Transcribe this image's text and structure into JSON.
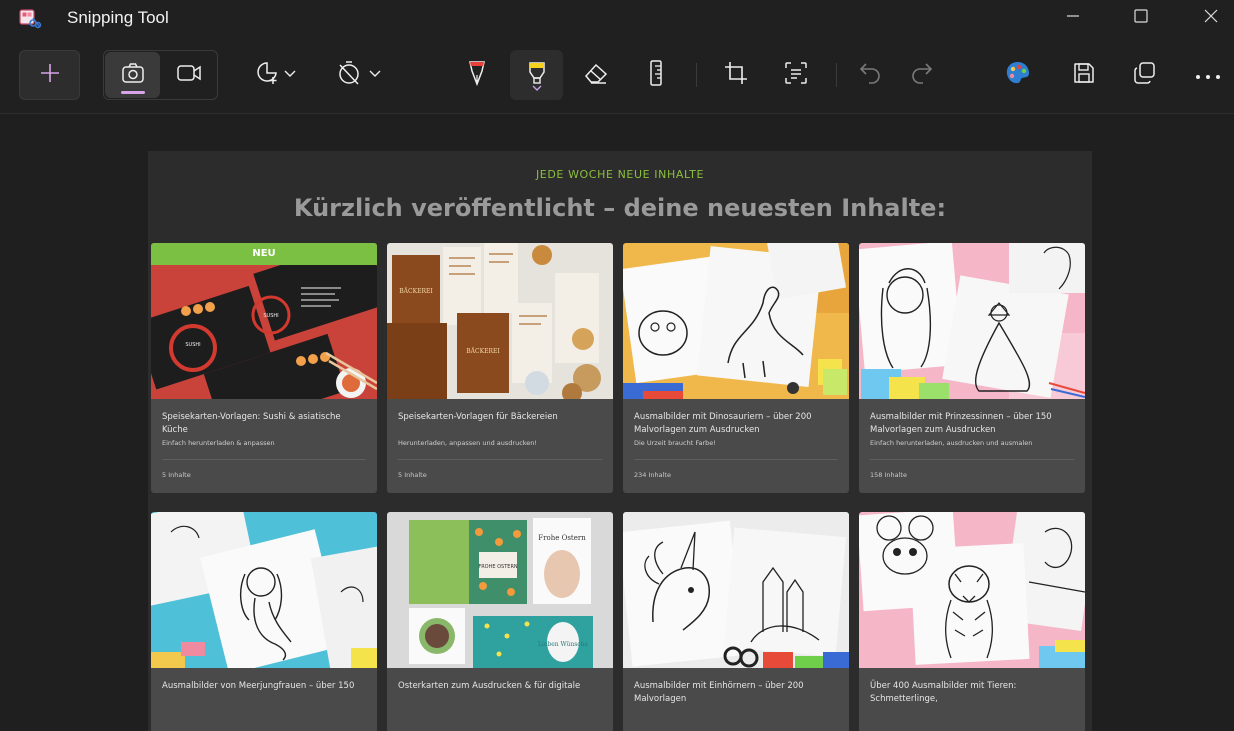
{
  "app": {
    "title": "Snipping Tool",
    "icon": "snipping-tool-icon"
  },
  "window_controls": [
    "minimize-icon",
    "maximize-icon",
    "close-icon"
  ],
  "toolbar": {
    "new": "plus-icon",
    "modes": [
      "camera-icon",
      "video-icon"
    ],
    "tools": [
      "shape-icon",
      "timer-off-icon",
      "pen-icon",
      "highlighter-icon",
      "eraser-icon",
      "ruler-icon",
      "crop-icon",
      "text-actions-icon",
      "undo-icon",
      "redo-icon",
      "paint-icon",
      "save-icon",
      "copy-icon",
      "more-icon"
    ],
    "accent": "#d8a4e8"
  },
  "page": {
    "eyebrow": "JEDE WOCHE NEUE INHALTE",
    "headline": "Kürzlich veröffentlicht – deine neuesten Inhalte:",
    "badge": "NEU",
    "colors": {
      "eyebrow": "#8bbf3c",
      "badge": "#7cc043"
    }
  },
  "cards": [
    {
      "title": "Speisekarten-Vorlagen: Sushi & asiatische Küche",
      "subtitle": "Einfach herunterladen & anpassen",
      "count": "5 Inhalte"
    },
    {
      "title": "Speisekarten-Vorlagen für Bäckereien",
      "subtitle": "Herunterladen, anpassen und ausdrucken!",
      "count": "5 Inhalte"
    },
    {
      "title": "Ausmalbilder mit Dinosauriern – über 200 Malvorlagen zum Ausdrucken",
      "subtitle": "Die Urzeit braucht Farbe!",
      "count": "234 Inhalte"
    },
    {
      "title": "Ausmalbilder mit Prinzessinnen – über 150 Malvorlagen zum Ausdrucken",
      "subtitle": "Einfach herunterladen, ausdrucken und ausmalen",
      "count": "158 Inhalte"
    },
    {
      "title": "Ausmalbilder von Meerjungfrauen – über 150",
      "subtitle": "",
      "count": ""
    },
    {
      "title": "Osterkarten zum Ausdrucken & für digitale",
      "subtitle": "",
      "count": ""
    },
    {
      "title": "Ausmalbilder mit Einhörnern – über 200 Malvorlagen",
      "subtitle": "",
      "count": ""
    },
    {
      "title": "Über 400 Ausmalbilder mit Tieren: Schmetterlinge,",
      "subtitle": "",
      "count": ""
    }
  ],
  "artwork": {
    "sushi_card_text": [
      "SUSHI",
      "SUSHI"
    ],
    "bakery_card_text": [
      "BÄCKEREI",
      "BÄCKEREI"
    ],
    "easter_card_text": [
      "Frohe Ostern",
      "FROHE OSTERN",
      "Lieben Wünsche"
    ]
  }
}
